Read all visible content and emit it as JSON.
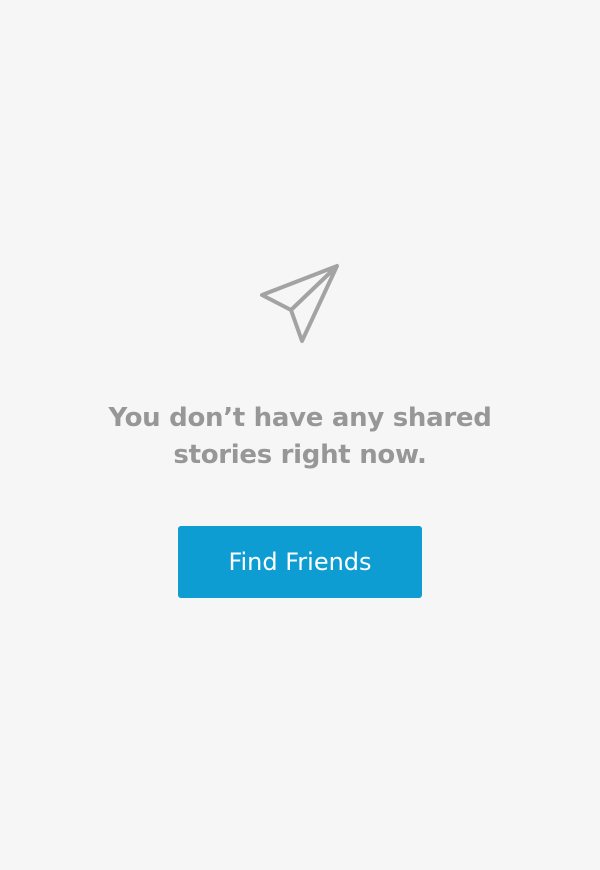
{
  "empty_state": {
    "icon": "paper-plane-icon",
    "message": "You don’t have any shared stories right now.",
    "button_label": "Find Friends"
  },
  "colors": {
    "background": "#f6f6f6",
    "text": "#979797",
    "button": "#0d9dd3",
    "button_text": "#ffffff"
  }
}
